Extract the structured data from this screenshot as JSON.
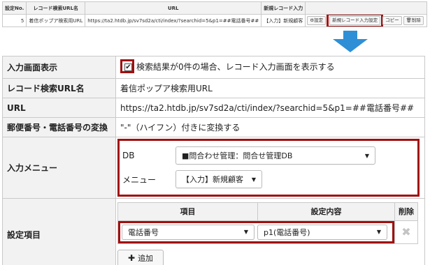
{
  "summary": {
    "headers": [
      "設定No.",
      "レコード検索URL名",
      "URL",
      "新規レコード入力",
      ""
    ],
    "row": {
      "no": "5",
      "name": "着信ポップア検索用URL",
      "url": "https://ta2.htdb.jp/sv7sd2a/cti/index/?searchid=5&p1=##電話番号##",
      "new_record": "【入力】新規顧客",
      "btn_settings": "設定",
      "btn_new_record_setting": "新規レコード入力設定",
      "btn_copy": "コピー",
      "btn_delete": "削除"
    }
  },
  "form": {
    "input_screen": {
      "label": "入力画面表示",
      "checkbox_text": "検索結果が0件の場合、レコード入力画面を表示する",
      "checked": true
    },
    "search_url_name": {
      "label": "レコード検索URL名",
      "value": "着信ポップア検索用URL"
    },
    "url": {
      "label": "URL",
      "value": "https://ta2.htdb.jp/sv7sd2a/cti/index/?searchid=5&p1=##電話番号##"
    },
    "postal_phone": {
      "label": "郵便番号・電話番号の変換",
      "value": "\"-\"（ハイフン）付きに変換する"
    },
    "input_menu": {
      "label": "入力メニュー",
      "db_label": "DB",
      "db_value": "■問合わせ管理：問合せ管理DB",
      "menu_label": "メニュー",
      "menu_value": "【入力】新規顧客"
    },
    "settings": {
      "label": "設定項目",
      "col_item": "項目",
      "col_content": "設定内容",
      "col_delete": "削除",
      "rows": [
        {
          "item": "電話番号",
          "content": "p1(電話番号)"
        }
      ],
      "add_label": "追加"
    }
  },
  "colors": {
    "highlight": "#a01010",
    "arrow": "#2e8fd6",
    "label_bg": "#f2f2f2"
  }
}
